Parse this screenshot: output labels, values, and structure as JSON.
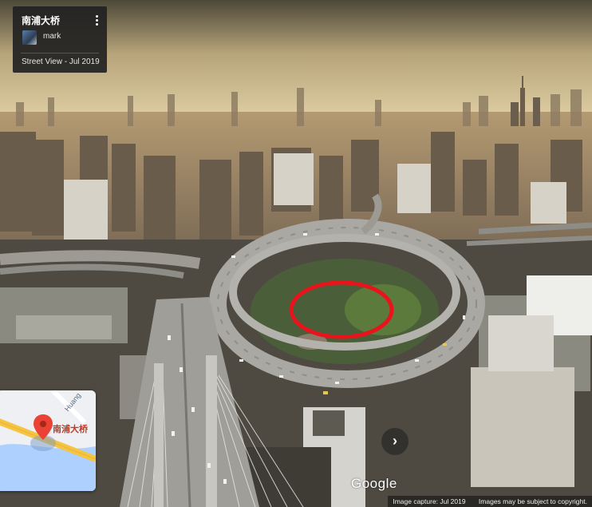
{
  "info_card": {
    "title": "南浦大桥",
    "author": "mark",
    "date_line": "Street View - Jul 2019",
    "menu_icon": "more-vert-icon"
  },
  "minimap": {
    "road_label": "Huang",
    "place_label": "南浦大桥",
    "pin_icon": "map-pin-icon"
  },
  "navigation": {
    "arrow_glyph": "›",
    "arrow_icon": "chevron-right-icon"
  },
  "branding": {
    "logo_text": "Google"
  },
  "footer": {
    "capture_text": "Image capture: Jul 2019",
    "copyright_text": "Images may be subject to copyright."
  },
  "highlight": {
    "color": "#e8131b"
  }
}
